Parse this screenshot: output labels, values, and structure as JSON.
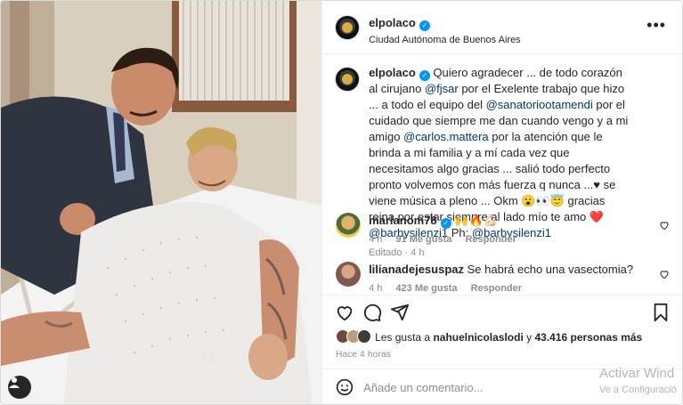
{
  "header": {
    "username": "elpolaco",
    "location": "Ciudad Autónoma de Buenos Aires",
    "more_icon": "more-horizontal-icon"
  },
  "caption": {
    "username": "elpolaco",
    "segments": [
      {
        "type": "text",
        "value": " Quiero agradecer ... de todo corazón al cirujano "
      },
      {
        "type": "mention",
        "value": "@fjsar"
      },
      {
        "type": "text",
        "value": " por el Exelente trabajo que hizo ... a todo el equipo del "
      },
      {
        "type": "mention",
        "value": "@sanatoriootamendi"
      },
      {
        "type": "text",
        "value": " por el cuidado que siempre me dan cuando vengo y a mi amigo "
      },
      {
        "type": "mention",
        "value": "@carlos.mattera"
      },
      {
        "type": "text",
        "value": " por la atención que le brinda a mi familia y a mí cada vez que necesitamos algo gracias ... salió todo perfecto pronto volvemos con más fuerza q nunca ...♥ se viene música a pleno ... Okm 😮👀😇 gracias reina por estar siempre al lado mío te amo ❤️ "
      },
      {
        "type": "mention",
        "value": "@barbysilenzi1"
      },
      {
        "type": "text",
        "value": " Ph: "
      },
      {
        "type": "mention",
        "value": "@barbysilenzi1"
      }
    ],
    "edited": "Editado · 4 h"
  },
  "comments": [
    {
      "username": "marianom78",
      "verified": true,
      "text": "🙌🔥💪🏻",
      "time": "4 h",
      "likes": "91 Me gusta",
      "reply": "Responder"
    },
    {
      "username": "lilianadejesuspaz",
      "verified": false,
      "text": "Se habrá echo una vasectomia?",
      "time": "4 h",
      "likes": "423 Me gusta",
      "reply": "Responder"
    }
  ],
  "likes": {
    "prefix": "Les gusta a ",
    "first_user": "nahuelnicolaslodi",
    "middle": " y ",
    "count": "43.416 personas más"
  },
  "time_ago": "Hace 4 horas",
  "add_comment": {
    "placeholder": "Añade un comentario..."
  },
  "watermark": {
    "line1": "Activar Wind",
    "line2": "Ve a Configuració"
  },
  "colors": {
    "link": "#00376b",
    "verified": "#0095f6",
    "muted": "#8e8e8e"
  }
}
